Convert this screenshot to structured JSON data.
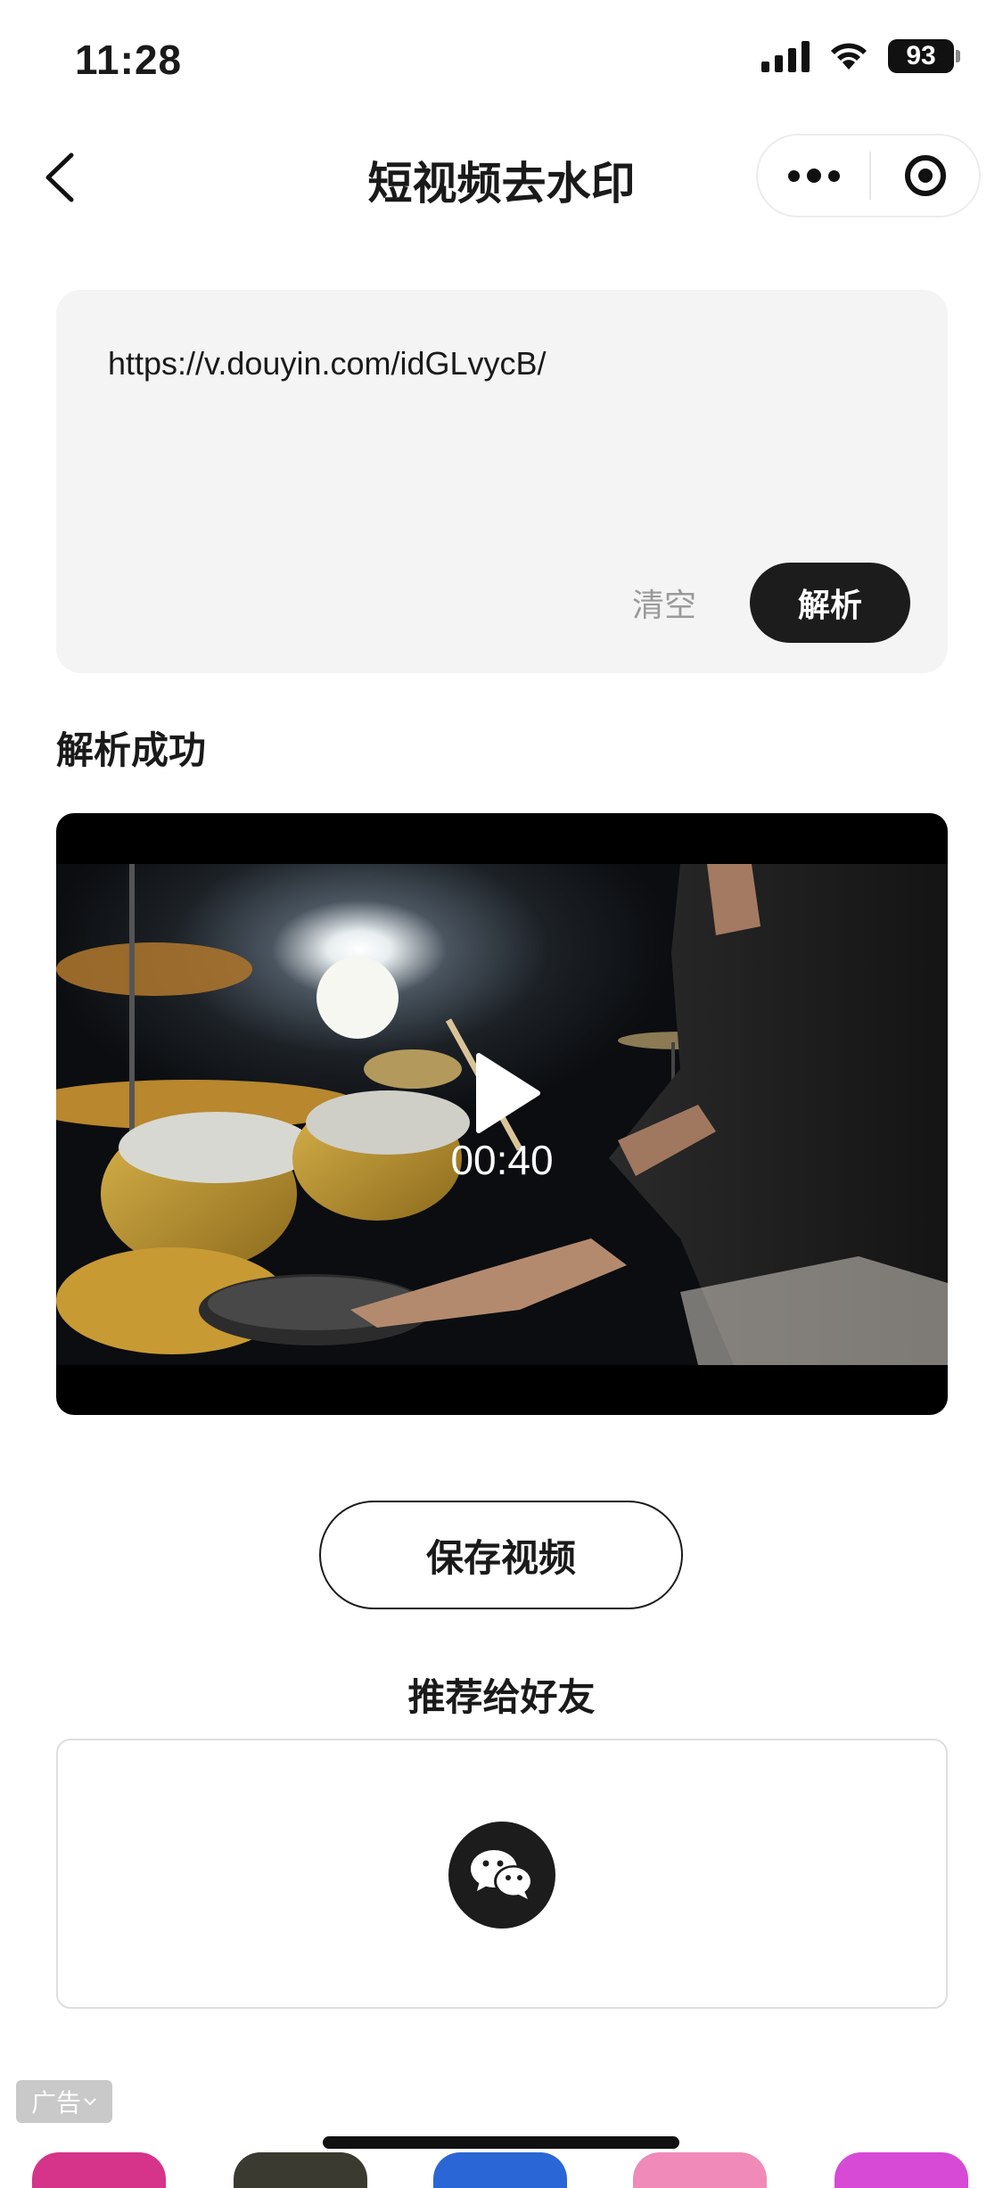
{
  "status_bar": {
    "time": "11:28",
    "battery": "93"
  },
  "nav": {
    "title": "短视频去水印"
  },
  "input": {
    "url": "https://v.douyin.com/idGLvycB/",
    "clear_label": "清空",
    "parse_label": "解析"
  },
  "result": {
    "label": "解析成功",
    "video_duration": "00:40"
  },
  "actions": {
    "save_label": "保存视频",
    "recommend_label": "推荐给好友"
  },
  "ad": {
    "label": "广告"
  },
  "colors": {
    "primary_dark": "#1c1c1c",
    "card_bg": "#f4f4f4",
    "muted_text": "#9a9a9a"
  }
}
